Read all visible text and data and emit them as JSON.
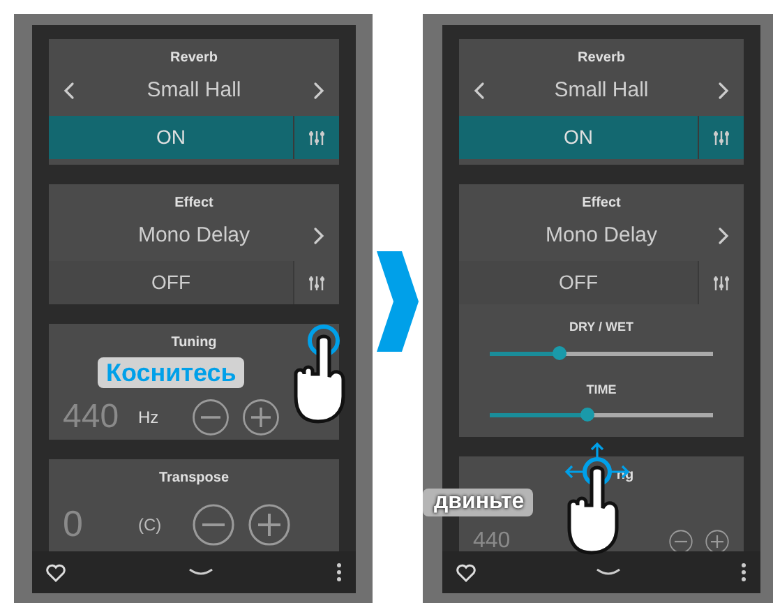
{
  "screens": [
    {
      "reverb": {
        "title": "Reverb",
        "preset": "Small Hall",
        "has_prev": true,
        "state_label": "ON",
        "on": true
      },
      "effect": {
        "title": "Effect",
        "preset": "Mono Delay",
        "has_prev": false,
        "state_label": "OFF",
        "on": false
      },
      "tuning": {
        "title": "Tuning",
        "value": "440",
        "unit": "Hz"
      },
      "transpose": {
        "title": "Transpose",
        "value": "0",
        "key": "(C)"
      },
      "gesture": {
        "kind": "tap",
        "label": "Коснитесь"
      }
    },
    {
      "reverb": {
        "title": "Reverb",
        "preset": "Small Hall",
        "has_prev": true,
        "state_label": "ON",
        "on": true
      },
      "effect": {
        "title": "Effect",
        "preset": "Mono Delay",
        "has_prev": false,
        "state_label": "OFF",
        "on": false,
        "sliders": [
          {
            "label": "DRY / WET",
            "level": 0.31
          },
          {
            "label": "TIME",
            "level": 0.44
          }
        ]
      },
      "tuning": {
        "title": "ng",
        "value": "440"
      },
      "gesture": {
        "kind": "drag",
        "label": "двиньте"
      }
    }
  ]
}
